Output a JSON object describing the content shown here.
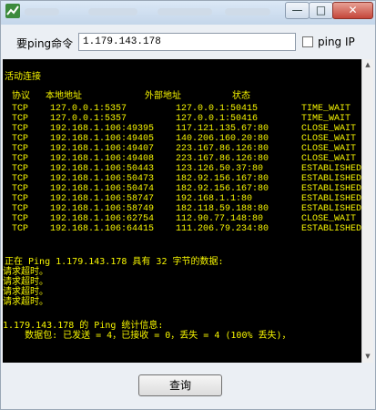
{
  "window": {
    "title_blurred": true,
    "buttons": {
      "minimize": "—",
      "maximize": "□",
      "close": "✕"
    }
  },
  "toolbar": {
    "label": "要ping命令",
    "input_value": "1.179.143.178",
    "checkbox_checked": false,
    "checkbox_label": "ping IP"
  },
  "console": {
    "active_connections_title": "活动连接",
    "headers": {
      "proto": "协议",
      "local": "本地地址",
      "foreign": "外部地址",
      "state": "状态"
    },
    "connections": [
      {
        "proto": "TCP",
        "local": "127.0.0.1:5357",
        "foreign": "127.0.0.1:50415",
        "state": "TIME_WAIT"
      },
      {
        "proto": "TCP",
        "local": "127.0.0.1:5357",
        "foreign": "127.0.0.1:50416",
        "state": "TIME_WAIT"
      },
      {
        "proto": "TCP",
        "local": "192.168.1.106:49395",
        "foreign": "117.121.135.67:80",
        "state": "CLOSE_WAIT"
      },
      {
        "proto": "TCP",
        "local": "192.168.1.106:49405",
        "foreign": "140.206.160.20:80",
        "state": "CLOSE_WAIT"
      },
      {
        "proto": "TCP",
        "local": "192.168.1.106:49407",
        "foreign": "223.167.86.126:80",
        "state": "CLOSE_WAIT"
      },
      {
        "proto": "TCP",
        "local": "192.168.1.106:49408",
        "foreign": "223.167.86.126:80",
        "state": "CLOSE_WAIT"
      },
      {
        "proto": "TCP",
        "local": "192.168.1.106:50443",
        "foreign": "123.126.50.37:80",
        "state": "ESTABLISHED"
      },
      {
        "proto": "TCP",
        "local": "192.168.1.106:50473",
        "foreign": "182.92.156.167:80",
        "state": "ESTABLISHED"
      },
      {
        "proto": "TCP",
        "local": "192.168.1.106:50474",
        "foreign": "182.92.156.167:80",
        "state": "ESTABLISHED"
      },
      {
        "proto": "TCP",
        "local": "192.168.1.106:58747",
        "foreign": "192.168.1.1:80",
        "state": "ESTABLISHED"
      },
      {
        "proto": "TCP",
        "local": "192.168.1.106:58749",
        "foreign": "182.118.59.188:80",
        "state": "ESTABLISHED"
      },
      {
        "proto": "TCP",
        "local": "192.168.1.106:62754",
        "foreign": "112.90.77.148:80",
        "state": "CLOSE_WAIT"
      },
      {
        "proto": "TCP",
        "local": "192.168.1.106:64415",
        "foreign": "111.206.79.234:80",
        "state": "ESTABLISHED"
      }
    ],
    "ping_header": "正在 Ping 1.179.143.178 具有 32 字节的数据:",
    "timeouts": [
      "请求超时。",
      "请求超时。",
      "请求超时。",
      "请求超时。"
    ],
    "stats_header": "1.179.143.178 的 Ping 统计信息:",
    "stats_line": "    数据包: 已发送 = 4，已接收 = 0，丢失 = 4 (100% 丢失)，"
  },
  "actions": {
    "query_button": "查询"
  },
  "colors": {
    "console_bg": "#000000",
    "console_text": "#f6f500"
  }
}
